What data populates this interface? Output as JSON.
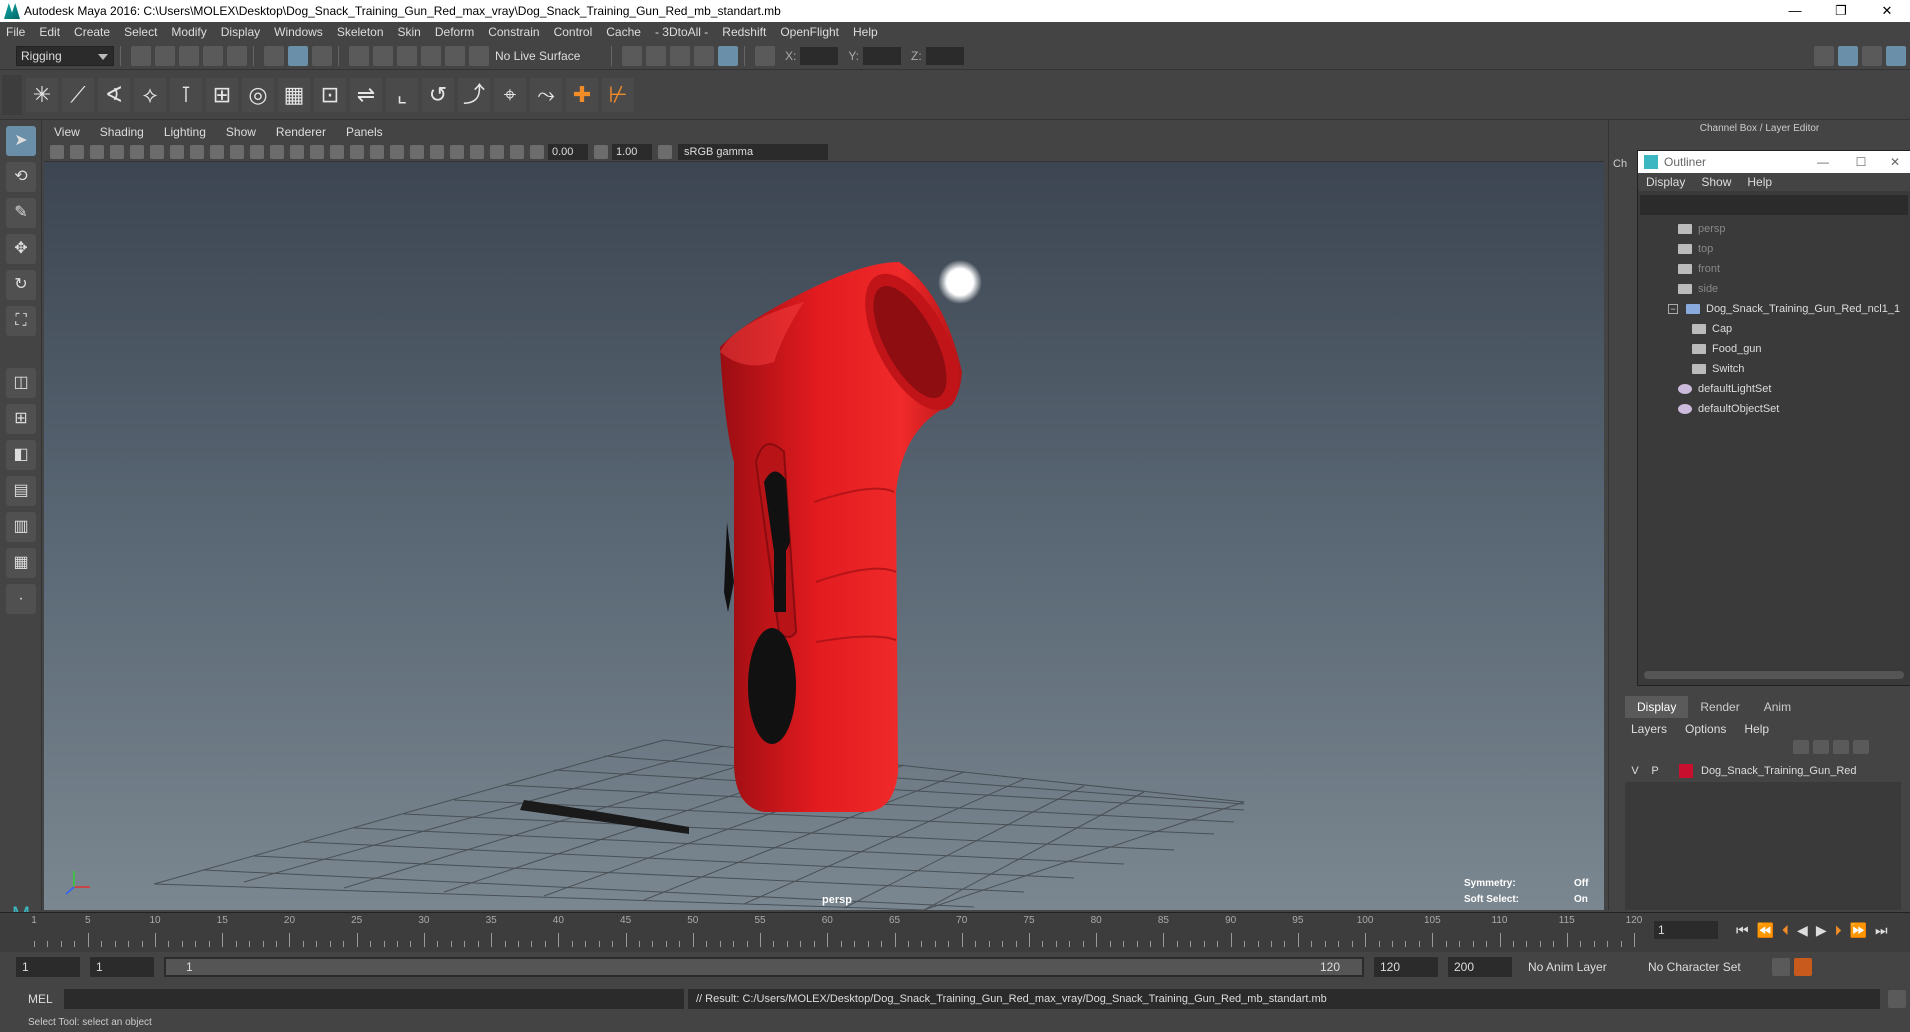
{
  "window": {
    "title": "Autodesk Maya 2016: C:\\Users\\MOLEX\\Desktop\\Dog_Snack_Training_Gun_Red_max_vray\\Dog_Snack_Training_Gun_Red_mb_standart.mb"
  },
  "menubar": [
    "File",
    "Edit",
    "Create",
    "Select",
    "Modify",
    "Display",
    "Windows",
    "Skeleton",
    "Skin",
    "Deform",
    "Constrain",
    "Control",
    "Cache",
    "- 3DtoAll -",
    "Redshift",
    "OpenFlight",
    "Help"
  ],
  "toolbar": {
    "mode": "Rigging",
    "live_surface": "No Live Surface",
    "coord_x": "X:",
    "coord_y": "Y:",
    "coord_z": "Z:"
  },
  "viewport": {
    "menu": [
      "View",
      "Shading",
      "Lighting",
      "Show",
      "Renderer",
      "Panels"
    ],
    "exposure": "0.00",
    "gamma": "1.00",
    "colorspace": "sRGB gamma",
    "camera_label": "persp",
    "symmetry_label": "Symmetry:",
    "symmetry_value": "Off",
    "softselect_label": "Soft Select:",
    "softselect_value": "On"
  },
  "right_panel": {
    "header": "Channel Box / Layer Editor",
    "side_tab": "Ch"
  },
  "outliner": {
    "title": "Outliner",
    "menu": [
      "Display",
      "Show",
      "Help"
    ],
    "items": [
      {
        "label": "persp",
        "dim": true,
        "indent": 0
      },
      {
        "label": "top",
        "dim": true,
        "indent": 0
      },
      {
        "label": "front",
        "dim": true,
        "indent": 0
      },
      {
        "label": "side",
        "dim": true,
        "indent": 0
      },
      {
        "label": "Dog_Snack_Training_Gun_Red_ncl1_1",
        "dim": false,
        "indent": 0
      },
      {
        "label": "Cap",
        "dim": false,
        "indent": 1
      },
      {
        "label": "Food_gun",
        "dim": false,
        "indent": 1
      },
      {
        "label": "Switch",
        "dim": false,
        "indent": 1
      },
      {
        "label": "defaultLightSet",
        "dim": false,
        "indent": 0
      },
      {
        "label": "defaultObjectSet",
        "dim": false,
        "indent": 0
      }
    ]
  },
  "layer_editor": {
    "tabs": [
      "Display",
      "Render",
      "Anim"
    ],
    "menu": [
      "Layers",
      "Options",
      "Help"
    ],
    "layer": {
      "v": "V",
      "p": "P",
      "name": "Dog_Snack_Training_Gun_Red",
      "color": "#c8102e"
    }
  },
  "timeline": {
    "ticks": [
      1,
      5,
      10,
      15,
      20,
      25,
      30,
      35,
      40,
      45,
      50,
      55,
      60,
      65,
      70,
      75,
      80,
      85,
      90,
      95,
      100,
      105,
      110,
      115,
      120
    ],
    "current_frame": "1"
  },
  "range": {
    "start": "1",
    "inner_start": "1",
    "slider_start": "1",
    "slider_end": "120",
    "end": "120",
    "max": "200",
    "anim_layer": "No Anim Layer",
    "char_set": "No Character Set"
  },
  "command": {
    "lang": "MEL",
    "result": "// Result: C:/Users/MOLEX/Desktop/Dog_Snack_Training_Gun_Red_max_vray/Dog_Snack_Training_Gun_Red_mb_standart.mb"
  },
  "helpline": "Select Tool: select an object"
}
